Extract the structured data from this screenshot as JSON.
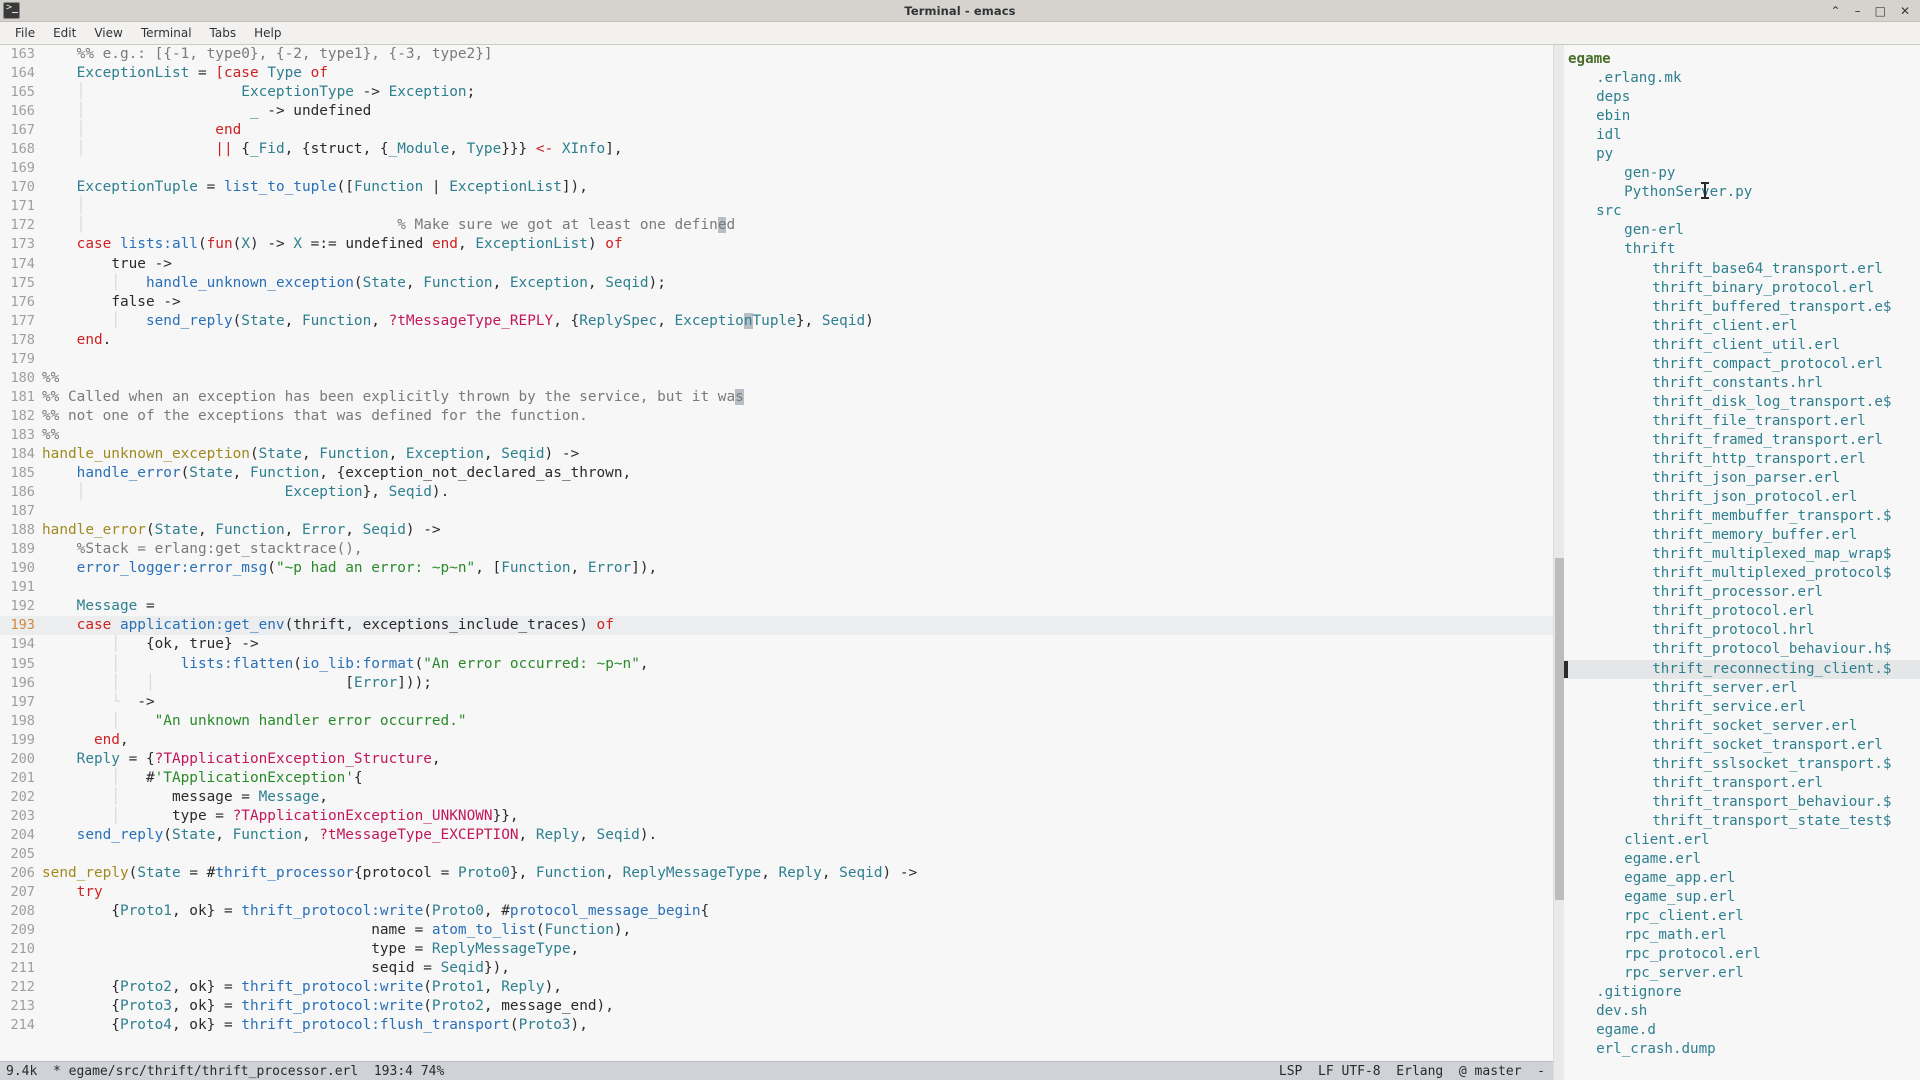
{
  "window": {
    "title": "Terminal - emacs",
    "app_icon": "terminal-icon",
    "controls": [
      {
        "name": "rollup-button",
        "glyph": "⌃"
      },
      {
        "name": "minimize-button",
        "glyph": "–"
      },
      {
        "name": "maximize-button",
        "glyph": "□"
      },
      {
        "name": "close-button",
        "glyph": "✕"
      }
    ]
  },
  "menubar": {
    "items": [
      "File",
      "Edit",
      "View",
      "Terminal",
      "Tabs",
      "Help"
    ]
  },
  "editor": {
    "first_line": 163,
    "current_line": 193,
    "lines": [
      {
        "n": 163,
        "html": "    <c class=\"cmt\">%% e.g.: [{-1, type0}, {-2, type1}, {-3, type2}]</c>"
      },
      {
        "n": 164,
        "html": "    <c class=\"var\">ExceptionList</c> <c class=\"op\">=</c> <c class=\"kwr\">[</c><c class=\"kwr\">case</c> <c class=\"var\">Type</c> <c class=\"kwr\">of</c>"
      },
      {
        "n": 165,
        "html": "    <c class=\"ind\">│</c>                  <c class=\"var\">ExceptionType</c> <c class=\"op\">-&gt;</c> <c class=\"var\">Exception</c>;"
      },
      {
        "n": 166,
        "html": "    <c class=\"ind\">│</c>                   <c class=\"var\">_</c> <c class=\"op\">-&gt;</c> <c class=\"atom\">undefined</c>"
      },
      {
        "n": 167,
        "html": "    <c class=\"ind\">│</c>               <c class=\"kwr\">end</c>"
      },
      {
        "n": 168,
        "html": "    <c class=\"ind\">│</c>               <c class=\"kwr\">||</c> {<c class=\"var\">_Fid</c>, {<c class=\"atom\">struct</c>, {<c class=\"var\">_Module</c>, <c class=\"var\">Type</c>}}} <c class=\"kwr\">&lt;-</c> <c class=\"var\">XInfo</c>],"
      },
      {
        "n": 169,
        "html": ""
      },
      {
        "n": 170,
        "html": "    <c class=\"var\">ExceptionTuple</c> <c class=\"op\">=</c> <c class=\"fn\">list_to_tuple</c>([<c class=\"var\">Function</c> | <c class=\"var\">ExceptionList</c>]),"
      },
      {
        "n": 171,
        "html": "    <c class=\"ind\">│</c>"
      },
      {
        "n": 172,
        "html": "    <c class=\"ind\">│</c>                                    <c class=\"cmt\">% Make sure we got at least one defin</c><c class=\"cmt blockcur\">e</c><c class=\"cmt\">d</c>"
      },
      {
        "n": 173,
        "html": "    <c class=\"kwr\">case</c> <c class=\"fn\">lists:all</c>(<c class=\"kwr\">fun</c>(<c class=\"var\">X</c>) <c class=\"op\">-&gt;</c> <c class=\"var\">X</c> <c class=\"op\">=:=</c> <c class=\"atom\">undefined</c> <c class=\"kwr\">end</c>, <c class=\"var\">ExceptionList</c>) <c class=\"kwr\">of</c>"
      },
      {
        "n": 174,
        "html": "        <c class=\"atom\">true</c> <c class=\"op\">-&gt;</c>"
      },
      {
        "n": 175,
        "html": "        <c class=\"ind\">│</c>   <c class=\"fn\">handle_unknown_exception</c>(<c class=\"var\">State</c>, <c class=\"var\">Function</c>, <c class=\"var\">Exception</c>, <c class=\"var\">Seqid</c>);"
      },
      {
        "n": 176,
        "html": "        <c class=\"atom\">false</c> <c class=\"op\">-&gt;</c>"
      },
      {
        "n": 177,
        "html": "        <c class=\"ind\">│</c>   <c class=\"fn\">send_reply</c>(<c class=\"var\">State</c>, <c class=\"var\">Function</c>, <c class=\"mac\">?tMessageType_REPLY</c>, {<c class=\"var\">ReplySpec</c>, <c class=\"var\">Exceptio</c><c class=\"var blockcur\">n</c><c class=\"var\">Tuple</c>}, <c class=\"var\">Seqid</c>)"
      },
      {
        "n": 178,
        "html": "    <c class=\"kwr\">end</c>."
      },
      {
        "n": 179,
        "html": ""
      },
      {
        "n": 180,
        "html": "<c class=\"cmt\">%%</c>"
      },
      {
        "n": 181,
        "html": "<c class=\"cmt\">%% Called when an exception has been explicitly thrown by the service, but it wa</c><c class=\"cmt blockcur\">s</c>"
      },
      {
        "n": 182,
        "html": "<c class=\"cmt\">%% not one of the exceptions that was defined for the function.</c>"
      },
      {
        "n": 183,
        "html": "<c class=\"cmt\">%%</c>"
      },
      {
        "n": 184,
        "html": "<c class=\"fnd\">handle_unknown_exception</c>(<c class=\"var\">State</c>, <c class=\"var\">Function</c>, <c class=\"var\">Exception</c>, <c class=\"var\">Seqid</c>) <c class=\"op\">-&gt;</c>"
      },
      {
        "n": 185,
        "html": "    <c class=\"fn\">handle_error</c>(<c class=\"var\">State</c>, <c class=\"var\">Function</c>, {<c class=\"atom\">exception_not_declared_as_thrown</c>,"
      },
      {
        "n": 186,
        "html": "    <c class=\"ind\">│</c>                       <c class=\"var\">Exception</c>}, <c class=\"var\">Seqid</c>)."
      },
      {
        "n": 187,
        "html": ""
      },
      {
        "n": 188,
        "html": "<c class=\"fnd\">handle_error</c>(<c class=\"var\">State</c>, <c class=\"var\">Function</c>, <c class=\"var\">Error</c>, <c class=\"var\">Seqid</c>) <c class=\"op\">-&gt;</c>"
      },
      {
        "n": 189,
        "html": "    <c class=\"cmt\">%Stack = erlang:get_stacktrace(),</c>"
      },
      {
        "n": 190,
        "html": "    <c class=\"fn\">error_logger:error_msg</c>(<c class=\"str\">\"~p had an error: ~p~n\"</c>, [<c class=\"var\">Function</c>, <c class=\"var\">Error</c>]),"
      },
      {
        "n": 191,
        "html": ""
      },
      {
        "n": 192,
        "html": "    <c class=\"var\">Message</c> <c class=\"op\">=</c>"
      },
      {
        "n": 193,
        "html": "    <c class=\"kwr\">case</c> <c class=\"fn\">application:get_env</c>(<c class=\"atom\">thrift</c>, <c class=\"atom\">exceptions_include_traces</c>) <c class=\"kwr\">of</c>"
      },
      {
        "n": 194,
        "html": "        <c class=\"ind\">│</c>   {<c class=\"atom\">ok</c>, <c class=\"atom\">true</c>} <c class=\"op\">-&gt;</c>"
      },
      {
        "n": 195,
        "html": "        <c class=\"ind\">│</c>       <c class=\"fn\">lists:flatten</c>(<c class=\"fn\">io_lib:format</c>(<c class=\"str\">\"An error occurred: ~p~n\"</c>,"
      },
      {
        "n": 196,
        "html": "        <c class=\"ind\">│</c>   <c class=\"ind\">│</c>                      [<c class=\"var\">Error</c>]));"
      },
      {
        "n": 197,
        "html": "        <c class=\"ind\">└</c>  <c class=\"op\">-&gt;</c>"
      },
      {
        "n": 198,
        "html": "        <c class=\"ind\">│</c>    <c class=\"str\">\"An unknown handler error occurred.\"</c>"
      },
      {
        "n": 199,
        "html": "      <c class=\"kwr\">end</c>,"
      },
      {
        "n": 200,
        "html": "    <c class=\"var\">Reply</c> <c class=\"op\">=</c> {<c class=\"mac\">?TApplicationException_Structure</c>,"
      },
      {
        "n": 201,
        "html": "        <c class=\"ind\">│</c>   #<c class=\"str\">'TApplicationException'</c>{"
      },
      {
        "n": 202,
        "html": "        <c class=\"ind\">│</c>      <c class=\"atom\">message</c> <c class=\"op\">=</c> <c class=\"var\">Message</c>,"
      },
      {
        "n": 203,
        "html": "        <c class=\"ind\">│</c>      <c class=\"atom\">type</c> <c class=\"op\">=</c> <c class=\"mac\">?TApplicationException_UNKNOWN</c>}},"
      },
      {
        "n": 204,
        "html": "    <c class=\"fn\">send_reply</c>(<c class=\"var\">State</c>, <c class=\"var\">Function</c>, <c class=\"mac\">?tMessageType_EXCEPTION</c>, <c class=\"var\">Reply</c>, <c class=\"var\">Seqid</c>)."
      },
      {
        "n": 205,
        "html": ""
      },
      {
        "n": 206,
        "html": "<c class=\"fnd\">send_reply</c>(<c class=\"var\">State</c> <c class=\"op\">=</c> #<c class=\"fn\">thrift_processor</c>{<c class=\"atom\">protocol</c> <c class=\"op\">=</c> <c class=\"var\">Proto0</c>}, <c class=\"var\">Function</c>, <c class=\"var\">ReplyMessageType</c>, <c class=\"var\">Reply</c>, <c class=\"var\">Seqid</c>) <c class=\"op\">-&gt;</c>"
      },
      {
        "n": 207,
        "html": "    <c class=\"kwr\">try</c>"
      },
      {
        "n": 208,
        "html": "        {<c class=\"var\">Proto1</c>, <c class=\"atom\">ok</c>} <c class=\"op\">=</c> <c class=\"fn\">thrift_protocol:write</c>(<c class=\"var\">Proto0</c>, #<c class=\"fn\">protocol_message_begin</c>{"
      },
      {
        "n": 209,
        "html": "                                      <c class=\"atom\">name</c> <c class=\"op\">=</c> <c class=\"fn\">atom_to_list</c>(<c class=\"var\">Function</c>),"
      },
      {
        "n": 210,
        "html": "                                      <c class=\"atom\">type</c> <c class=\"op\">=</c> <c class=\"var\">ReplyMessageType</c>,"
      },
      {
        "n": 211,
        "html": "                                      <c class=\"atom\">seqid</c> <c class=\"op\">=</c> <c class=\"var\">Seqid</c>}),"
      },
      {
        "n": 212,
        "html": "        {<c class=\"var\">Proto2</c>, <c class=\"atom\">ok</c>} <c class=\"op\">=</c> <c class=\"fn\">thrift_protocol:write</c>(<c class=\"var\">Proto1</c>, <c class=\"var\">Reply</c>),"
      },
      {
        "n": 213,
        "html": "        {<c class=\"var\">Proto3</c>, <c class=\"atom\">ok</c>} <c class=\"op\">=</c> <c class=\"fn\">thrift_protocol:write</c>(<c class=\"var\">Proto2</c>, <c class=\"atom\">message_end</c>),"
      },
      {
        "n": 214,
        "html": "        {<c class=\"var\">Proto4</c>, <c class=\"atom\">ok</c>} <c class=\"op\">=</c> <c class=\"fn\">thrift_protocol:flush_transport</c>(<c class=\"var\">Proto3</c>),"
      }
    ]
  },
  "modeline": {
    "size": "9.4k",
    "modified": "*",
    "file": "egame/src/thrift/thrift_processor.erl",
    "position": "193:4",
    "percent": "74%",
    "left_text": "9.4k  * egame/src/thrift/thrift_processor.erl  193:4 74%",
    "right_text": "LSP  LF UTF-8  Erlang  @ master  -"
  },
  "filetree": {
    "root": "egame",
    "selected_index": 32,
    "items": [
      {
        "label": "egame",
        "depth": 0,
        "kind": "root"
      },
      {
        "label": ".erlang.mk",
        "depth": 1,
        "kind": "file"
      },
      {
        "label": "deps",
        "depth": 1,
        "kind": "dir"
      },
      {
        "label": "ebin",
        "depth": 1,
        "kind": "dir"
      },
      {
        "label": "idl",
        "depth": 1,
        "kind": "dir"
      },
      {
        "label": "py",
        "depth": 1,
        "kind": "dir"
      },
      {
        "label": "gen-py",
        "depth": 2,
        "kind": "dir"
      },
      {
        "label": "PythonServer.py",
        "depth": 2,
        "kind": "file"
      },
      {
        "label": "src",
        "depth": 1,
        "kind": "dir"
      },
      {
        "label": "gen-erl",
        "depth": 2,
        "kind": "dir"
      },
      {
        "label": "thrift",
        "depth": 2,
        "kind": "dir"
      },
      {
        "label": "thrift_base64_transport.erl",
        "depth": 3,
        "kind": "file"
      },
      {
        "label": "thrift_binary_protocol.erl",
        "depth": 3,
        "kind": "file"
      },
      {
        "label": "thrift_buffered_transport.e$",
        "depth": 3,
        "kind": "file"
      },
      {
        "label": "thrift_client.erl",
        "depth": 3,
        "kind": "file"
      },
      {
        "label": "thrift_client_util.erl",
        "depth": 3,
        "kind": "file"
      },
      {
        "label": "thrift_compact_protocol.erl",
        "depth": 3,
        "kind": "file"
      },
      {
        "label": "thrift_constants.hrl",
        "depth": 3,
        "kind": "file"
      },
      {
        "label": "thrift_disk_log_transport.e$",
        "depth": 3,
        "kind": "file"
      },
      {
        "label": "thrift_file_transport.erl",
        "depth": 3,
        "kind": "file"
      },
      {
        "label": "thrift_framed_transport.erl",
        "depth": 3,
        "kind": "file"
      },
      {
        "label": "thrift_http_transport.erl",
        "depth": 3,
        "kind": "file"
      },
      {
        "label": "thrift_json_parser.erl",
        "depth": 3,
        "kind": "file"
      },
      {
        "label": "thrift_json_protocol.erl",
        "depth": 3,
        "kind": "file"
      },
      {
        "label": "thrift_membuffer_transport.$",
        "depth": 3,
        "kind": "file"
      },
      {
        "label": "thrift_memory_buffer.erl",
        "depth": 3,
        "kind": "file"
      },
      {
        "label": "thrift_multiplexed_map_wrap$",
        "depth": 3,
        "kind": "file"
      },
      {
        "label": "thrift_multiplexed_protocol$",
        "depth": 3,
        "kind": "file"
      },
      {
        "label": "thrift_processor.erl",
        "depth": 3,
        "kind": "file"
      },
      {
        "label": "thrift_protocol.erl",
        "depth": 3,
        "kind": "file"
      },
      {
        "label": "thrift_protocol.hrl",
        "depth": 3,
        "kind": "file"
      },
      {
        "label": "thrift_protocol_behaviour.h$",
        "depth": 3,
        "kind": "file"
      },
      {
        "label": "thrift_reconnecting_client.$",
        "depth": 3,
        "kind": "file"
      },
      {
        "label": "thrift_server.erl",
        "depth": 3,
        "kind": "file"
      },
      {
        "label": "thrift_service.erl",
        "depth": 3,
        "kind": "file"
      },
      {
        "label": "thrift_socket_server.erl",
        "depth": 3,
        "kind": "file"
      },
      {
        "label": "thrift_socket_transport.erl",
        "depth": 3,
        "kind": "file"
      },
      {
        "label": "thrift_sslsocket_transport.$",
        "depth": 3,
        "kind": "file"
      },
      {
        "label": "thrift_transport.erl",
        "depth": 3,
        "kind": "file"
      },
      {
        "label": "thrift_transport_behaviour.$",
        "depth": 3,
        "kind": "file"
      },
      {
        "label": "thrift_transport_state_test$",
        "depth": 3,
        "kind": "file"
      },
      {
        "label": "client.erl",
        "depth": 2,
        "kind": "file"
      },
      {
        "label": "egame.erl",
        "depth": 2,
        "kind": "file"
      },
      {
        "label": "egame_app.erl",
        "depth": 2,
        "kind": "file"
      },
      {
        "label": "egame_sup.erl",
        "depth": 2,
        "kind": "file"
      },
      {
        "label": "rpc_client.erl",
        "depth": 2,
        "kind": "file"
      },
      {
        "label": "rpc_math.erl",
        "depth": 2,
        "kind": "file"
      },
      {
        "label": "rpc_protocol.erl",
        "depth": 2,
        "kind": "file"
      },
      {
        "label": "rpc_server.erl",
        "depth": 2,
        "kind": "file"
      },
      {
        "label": ".gitignore",
        "depth": 1,
        "kind": "file"
      },
      {
        "label": "dev.sh",
        "depth": 1,
        "kind": "file"
      },
      {
        "label": "egame.d",
        "depth": 1,
        "kind": "file"
      },
      {
        "label": "erl_crash.dump",
        "depth": 1,
        "kind": "file"
      }
    ]
  },
  "colors": {
    "titlebar_bg": "#d6d3ce",
    "menubar_bg": "#f2f1f0",
    "editor_bg": "#f7f7f7",
    "modeline_bg": "#cfd2d6",
    "current_line_bg": "#ecedef",
    "keyword": "#cc2222",
    "comment": "#7a7a7a",
    "string": "#2a8a2a",
    "variable": "#2e7f8f",
    "function": "#2a70b8",
    "function_def": "#a08a1e",
    "macro": "#c2185b",
    "line_number": "#9e9e9e",
    "current_line_number": "#d08740",
    "tree_text": "#2e7f8f",
    "tree_root": "#4a6e2a"
  }
}
